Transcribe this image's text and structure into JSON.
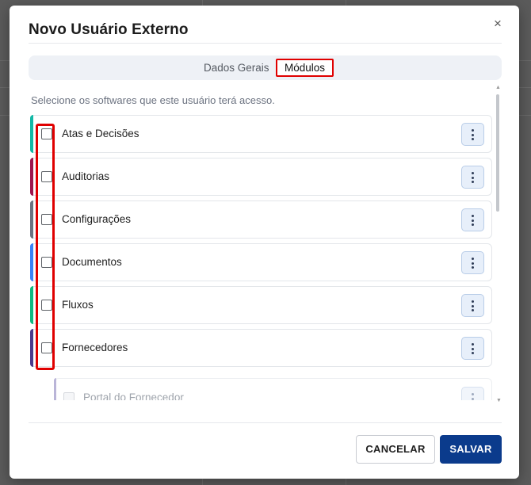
{
  "modal": {
    "title": "Novo Usuário Externo",
    "close_label": "×"
  },
  "tabs": [
    {
      "label": "Dados Gerais",
      "selected": false
    },
    {
      "label": "Módulos",
      "selected": true
    }
  ],
  "hint": "Selecione os softwares que este usuário terá acesso.",
  "modules": [
    {
      "label": "Atas e Decisões",
      "checked": false,
      "accent": "#14b8a6"
    },
    {
      "label": "Auditorias",
      "checked": false,
      "accent": "#9d174d"
    },
    {
      "label": "Configurações",
      "checked": false,
      "accent": "#6b7280"
    },
    {
      "label": "Documentos",
      "checked": false,
      "accent": "#3b82f6"
    },
    {
      "label": "Fluxos",
      "checked": false,
      "accent": "#10b981"
    },
    {
      "label": "Fornecedores",
      "checked": false,
      "accent": "#4c3a8c"
    }
  ],
  "submodules": [
    {
      "label": "Portal do Fornecedor",
      "checked": false,
      "disabled": true
    }
  ],
  "footer": {
    "cancel_label": "CANCELAR",
    "save_label": "SALVAR"
  },
  "colors": {
    "primary": "#0b3b8c",
    "highlight": "#e00000"
  },
  "icons": {
    "close": "close-icon",
    "menu": "kebab-menu-icon"
  }
}
